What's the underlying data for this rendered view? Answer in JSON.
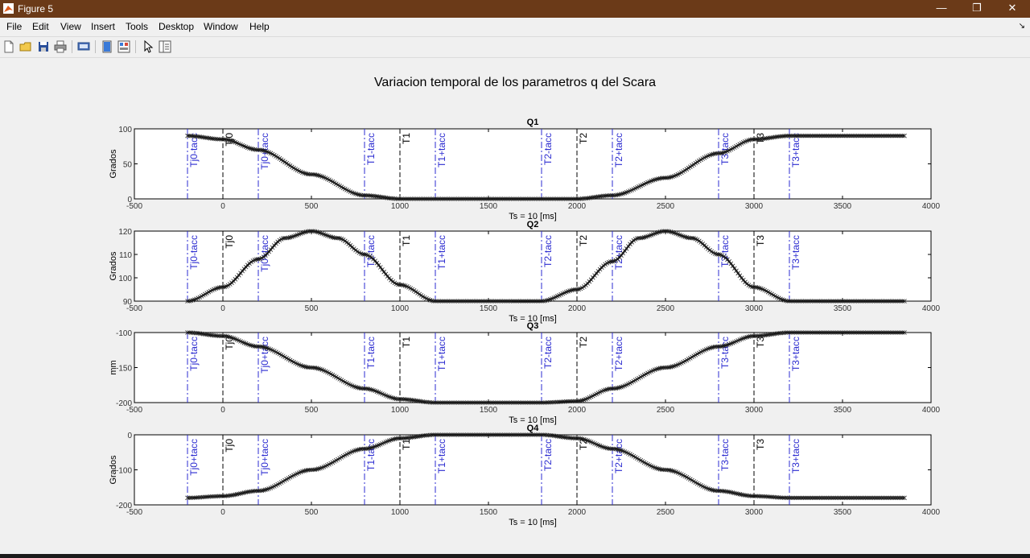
{
  "window": {
    "title": "Figure 5",
    "minimize_glyph": "—",
    "restore_glyph": "❐",
    "close_glyph": "✕",
    "accent": "#6b3a18"
  },
  "menu": {
    "items": [
      "File",
      "Edit",
      "View",
      "Insert",
      "Tools",
      "Desktop",
      "Window",
      "Help"
    ],
    "expand_glyph": "↘"
  },
  "toolbar": {
    "icons": [
      "new-figure-icon",
      "open-file-icon",
      "save-icon",
      "print-icon",
      "print-preview-icon",
      "hide-plot-tools-icon",
      "show-plot-tools-icon",
      "edit-plot-arrow-icon",
      "plot-browser-icon"
    ]
  },
  "figure": {
    "title": "Variacion temporal de los parametros q del Scara"
  },
  "chart_data": [
    {
      "type": "line",
      "title": "Q1",
      "xlabel": "Ts = 10 [ms]",
      "ylabel": "Grados",
      "xlim": [
        -500,
        4000
      ],
      "ylim": [
        0,
        100
      ],
      "xticks": [
        -500,
        0,
        500,
        1000,
        1500,
        2000,
        2500,
        3000,
        3500,
        4000
      ],
      "yticks": [
        0,
        50,
        100
      ],
      "series": [
        {
          "x": [
            -200,
            0,
            200,
            500,
            800,
            1000,
            1200,
            1800,
            2000,
            2200,
            2500,
            2800,
            3000,
            3200,
            3850
          ],
          "y": [
            90,
            85,
            70,
            35,
            5,
            0,
            0,
            0,
            0,
            5,
            30,
            65,
            85,
            90,
            90
          ]
        }
      ],
      "marker_lines": [
        {
          "x": -200,
          "label": "Tj0-tacc",
          "color": "#2b2bd0"
        },
        {
          "x": 0,
          "label": "Tj0",
          "color": "#000000"
        },
        {
          "x": 200,
          "label": "Tj0+tacc",
          "color": "#2b2bd0"
        },
        {
          "x": 800,
          "label": "T1-tacc",
          "color": "#2b2bd0"
        },
        {
          "x": 1000,
          "label": "T1",
          "color": "#000000"
        },
        {
          "x": 1200,
          "label": "T1+tacc",
          "color": "#2b2bd0"
        },
        {
          "x": 1800,
          "label": "T2-tacc",
          "color": "#2b2bd0"
        },
        {
          "x": 2000,
          "label": "T2",
          "color": "#000000"
        },
        {
          "x": 2200,
          "label": "T2+tacc",
          "color": "#2b2bd0"
        },
        {
          "x": 2800,
          "label": "T3-tacc",
          "color": "#2b2bd0"
        },
        {
          "x": 3000,
          "label": "T3",
          "color": "#000000"
        },
        {
          "x": 3200,
          "label": "T3+tacc",
          "color": "#2b2bd0"
        }
      ]
    },
    {
      "type": "line",
      "title": "Q2",
      "xlabel": "Ts = 10 [ms]",
      "ylabel": "Grados",
      "xlim": [
        -500,
        4000
      ],
      "ylim": [
        90,
        120
      ],
      "xticks": [
        -500,
        0,
        500,
        1000,
        1500,
        2000,
        2500,
        3000,
        3500,
        4000
      ],
      "yticks": [
        90,
        100,
        110,
        120
      ],
      "series": [
        {
          "x": [
            -200,
            0,
            200,
            350,
            500,
            650,
            800,
            1000,
            1200,
            1800,
            2000,
            2200,
            2350,
            2500,
            2650,
            2800,
            3000,
            3200,
            3850
          ],
          "y": [
            90,
            96,
            108,
            117,
            120,
            117,
            110,
            97,
            90,
            90,
            95,
            107,
            117,
            120,
            117,
            110,
            96,
            90,
            90
          ]
        }
      ],
      "marker_lines": [
        {
          "x": -200,
          "label": "Tj0-tacc",
          "color": "#2b2bd0"
        },
        {
          "x": 0,
          "label": "Tj0",
          "color": "#000000"
        },
        {
          "x": 200,
          "label": "Tj0+tacc",
          "color": "#2b2bd0"
        },
        {
          "x": 800,
          "label": "T1-tacc",
          "color": "#2b2bd0"
        },
        {
          "x": 1000,
          "label": "T1",
          "color": "#000000"
        },
        {
          "x": 1200,
          "label": "T1+tacc",
          "color": "#2b2bd0"
        },
        {
          "x": 1800,
          "label": "T2-tacc",
          "color": "#2b2bd0"
        },
        {
          "x": 2000,
          "label": "T2",
          "color": "#000000"
        },
        {
          "x": 2200,
          "label": "T2+tacc",
          "color": "#2b2bd0"
        },
        {
          "x": 2800,
          "label": "T3-tacc",
          "color": "#2b2bd0"
        },
        {
          "x": 3000,
          "label": "T3",
          "color": "#000000"
        },
        {
          "x": 3200,
          "label": "T3+tacc",
          "color": "#2b2bd0"
        }
      ]
    },
    {
      "type": "line",
      "title": "Q3",
      "xlabel": "Ts = 10 [ms]",
      "ylabel": "mm",
      "xlim": [
        -500,
        4000
      ],
      "ylim": [
        -200,
        -100
      ],
      "xticks": [
        -500,
        0,
        500,
        1000,
        1500,
        2000,
        2500,
        3000,
        3500,
        4000
      ],
      "yticks": [
        -200,
        -150,
        -100
      ],
      "series": [
        {
          "x": [
            -200,
            0,
            200,
            500,
            800,
            1000,
            1200,
            1800,
            2000,
            2200,
            2500,
            2800,
            3000,
            3200,
            3850
          ],
          "y": [
            -100,
            -105,
            -120,
            -150,
            -180,
            -195,
            -200,
            -200,
            -198,
            -180,
            -150,
            -120,
            -105,
            -100,
            -100
          ]
        }
      ],
      "marker_lines": [
        {
          "x": -200,
          "label": "Tj0-tacc",
          "color": "#2b2bd0"
        },
        {
          "x": 0,
          "label": "Tj0",
          "color": "#000000"
        },
        {
          "x": 200,
          "label": "Tj0+tacc",
          "color": "#2b2bd0"
        },
        {
          "x": 800,
          "label": "T1-tacc",
          "color": "#2b2bd0"
        },
        {
          "x": 1000,
          "label": "T1",
          "color": "#000000"
        },
        {
          "x": 1200,
          "label": "T1+tacc",
          "color": "#2b2bd0"
        },
        {
          "x": 1800,
          "label": "T2-tacc",
          "color": "#2b2bd0"
        },
        {
          "x": 2000,
          "label": "T2",
          "color": "#000000"
        },
        {
          "x": 2200,
          "label": "T2+tacc",
          "color": "#2b2bd0"
        },
        {
          "x": 2800,
          "label": "T3-tacc",
          "color": "#2b2bd0"
        },
        {
          "x": 3000,
          "label": "T3",
          "color": "#000000"
        },
        {
          "x": 3200,
          "label": "T3+tacc",
          "color": "#2b2bd0"
        }
      ]
    },
    {
      "type": "line",
      "title": "Q4",
      "xlabel": "Ts = 10 [ms]",
      "ylabel": "Grados",
      "xlim": [
        -500,
        4000
      ],
      "ylim": [
        -200,
        0
      ],
      "xticks": [
        -500,
        0,
        500,
        1000,
        1500,
        2000,
        2500,
        3000,
        3500,
        4000
      ],
      "yticks": [
        -200,
        -100,
        0
      ],
      "series": [
        {
          "x": [
            -200,
            0,
            200,
            500,
            800,
            1000,
            1200,
            1800,
            2000,
            2200,
            2500,
            2800,
            3000,
            3200,
            3850
          ],
          "y": [
            -180,
            -175,
            -160,
            -100,
            -40,
            -10,
            0,
            0,
            -10,
            -40,
            -100,
            -160,
            -175,
            -180,
            -180
          ]
        }
      ],
      "marker_lines": [
        {
          "x": -200,
          "label": "Tj0+tacc",
          "color": "#2b2bd0"
        },
        {
          "x": 0,
          "label": "Tj0",
          "color": "#000000"
        },
        {
          "x": 200,
          "label": "Tj0+tacc",
          "color": "#2b2bd0"
        },
        {
          "x": 800,
          "label": "T1-tacc",
          "color": "#2b2bd0"
        },
        {
          "x": 1000,
          "label": "T1",
          "color": "#000000"
        },
        {
          "x": 1200,
          "label": "T1+tacc",
          "color": "#2b2bd0"
        },
        {
          "x": 1800,
          "label": "T2-tacc",
          "color": "#2b2bd0"
        },
        {
          "x": 2000,
          "label": "T2",
          "color": "#000000"
        },
        {
          "x": 2200,
          "label": "T2+tacc",
          "color": "#2b2bd0"
        },
        {
          "x": 2800,
          "label": "T3-tacc",
          "color": "#2b2bd0"
        },
        {
          "x": 3000,
          "label": "T3",
          "color": "#000000"
        },
        {
          "x": 3200,
          "label": "T3+tacc",
          "color": "#2b2bd0"
        }
      ]
    }
  ]
}
